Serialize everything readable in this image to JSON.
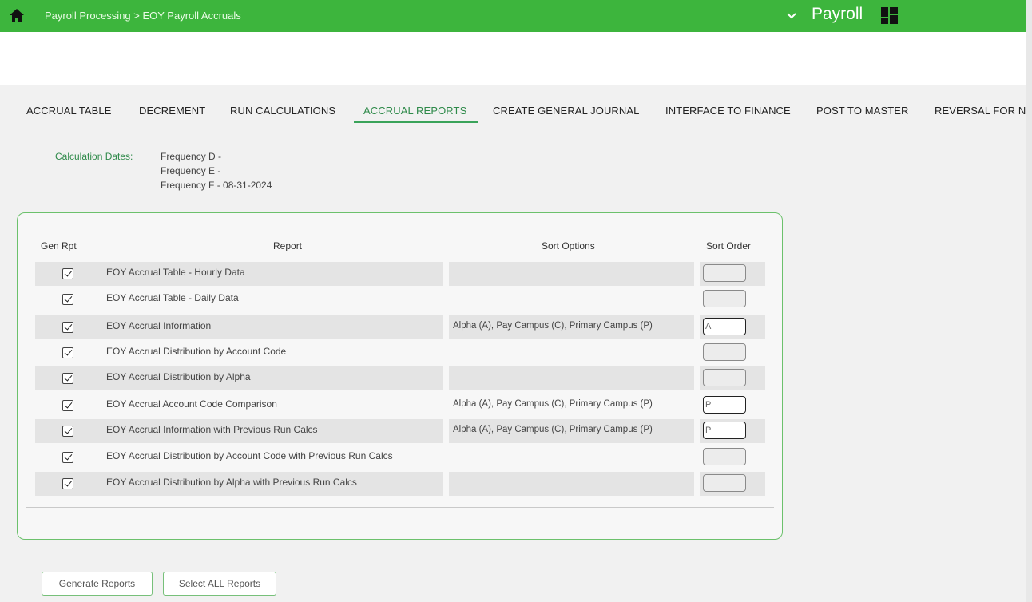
{
  "header": {
    "breadcrumb": "Payroll Processing > EOY Payroll Accruals",
    "app_name": "Payroll"
  },
  "tabs": [
    {
      "label": "ACCRUAL TABLE",
      "active": false
    },
    {
      "label": "DECREMENT",
      "active": false
    },
    {
      "label": "RUN CALCULATIONS",
      "active": false
    },
    {
      "label": "ACCRUAL REPORTS",
      "active": true
    },
    {
      "label": "CREATE GENERAL JOURNAL",
      "active": false
    },
    {
      "label": "INTERFACE TO FINANCE",
      "active": false
    },
    {
      "label": "POST TO MASTER",
      "active": false
    },
    {
      "label": "REVERSAL FOR N",
      "active": false
    }
  ],
  "calculation_dates": {
    "label": "Calculation Dates:",
    "lines": [
      "Frequency D -",
      "Frequency E -",
      "Frequency F - 08-31-2024"
    ]
  },
  "table": {
    "headers": {
      "gen_rpt": "Gen Rpt",
      "report": "Report",
      "sort_options": "Sort Options",
      "sort_order": "Sort Order"
    },
    "rows": [
      {
        "checked": true,
        "report": "EOY Accrual Table - Hourly Data",
        "sort_options": "",
        "sort_order": ""
      },
      {
        "checked": true,
        "report": "EOY Accrual Table - Daily Data",
        "sort_options": "",
        "sort_order": ""
      },
      {
        "checked": true,
        "report": "EOY Accrual Information",
        "sort_options": "Alpha (A), Pay Campus (C), Primary Campus (P)",
        "sort_order": "A"
      },
      {
        "checked": true,
        "report": "EOY Accrual Distribution by Account Code",
        "sort_options": "",
        "sort_order": ""
      },
      {
        "checked": true,
        "report": "EOY Accrual Distribution by Alpha",
        "sort_options": "",
        "sort_order": ""
      },
      {
        "checked": true,
        "report": "EOY Accrual Account Code Comparison",
        "sort_options": "Alpha (A), Pay Campus (C), Primary Campus (P)",
        "sort_order": "P"
      },
      {
        "checked": true,
        "report": "EOY Accrual Information with Previous Run Calcs",
        "sort_options": "Alpha (A), Pay Campus (C), Primary Campus (P)",
        "sort_order": "P"
      },
      {
        "checked": true,
        "report": "EOY Accrual Distribution by Account Code with Previous Run Calcs",
        "sort_options": "",
        "sort_order": ""
      },
      {
        "checked": true,
        "report": "EOY Accrual Distribution by Alpha with Previous Run Calcs",
        "sort_options": "",
        "sort_order": ""
      }
    ]
  },
  "buttons": {
    "generate": "Generate Reports",
    "select_all": "Select ALL Reports"
  },
  "colors": {
    "topbar": "#3db53d",
    "accent_green": "#2f8a4a",
    "panel_border": "#6cc16c"
  },
  "icons": [
    "home-icon",
    "chevron-down-icon",
    "grid-icon",
    "checkbox-icon"
  ]
}
